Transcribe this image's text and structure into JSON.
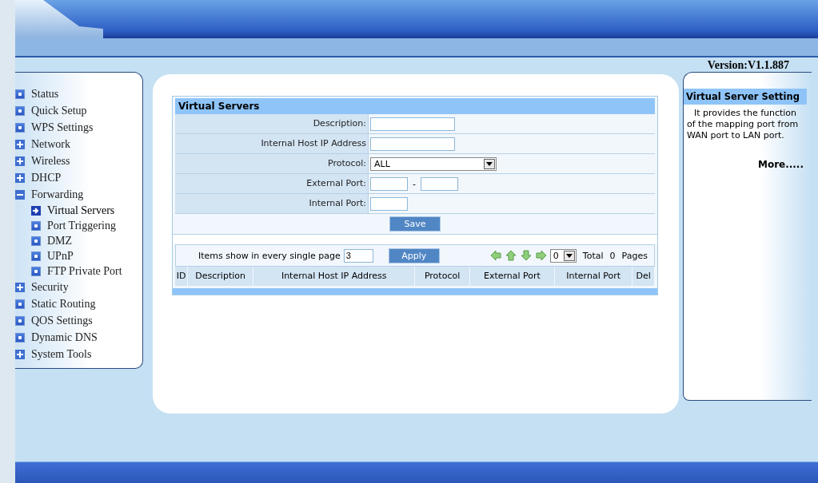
{
  "version": "Version:V1.1.887",
  "sidebar": {
    "items": [
      {
        "label": "Status",
        "kind": "page",
        "selected": false
      },
      {
        "label": "Quick Setup",
        "kind": "page",
        "selected": false
      },
      {
        "label": "WPS Settings",
        "kind": "page",
        "selected": false
      },
      {
        "label": "Network",
        "kind": "folder",
        "expanded": false,
        "selected": false
      },
      {
        "label": "Wireless",
        "kind": "folder",
        "expanded": false,
        "selected": false
      },
      {
        "label": "DHCP",
        "kind": "folder",
        "expanded": false,
        "selected": false
      },
      {
        "label": "Forwarding",
        "kind": "folder",
        "expanded": true,
        "selected": false,
        "children": [
          {
            "label": "Virtual Servers",
            "selected": true
          },
          {
            "label": "Port Triggering",
            "selected": false
          },
          {
            "label": "DMZ",
            "selected": false
          },
          {
            "label": "UPnP",
            "selected": false
          },
          {
            "label": "FTP Private Port",
            "selected": false
          }
        ]
      },
      {
        "label": "Security",
        "kind": "folder",
        "expanded": false,
        "selected": false
      },
      {
        "label": "Static Routing",
        "kind": "page",
        "selected": false
      },
      {
        "label": "QOS Settings",
        "kind": "page",
        "selected": false
      },
      {
        "label": "Dynamic DNS",
        "kind": "page",
        "selected": false
      },
      {
        "label": "System Tools",
        "kind": "folder",
        "expanded": false,
        "selected": false
      }
    ]
  },
  "form": {
    "title": "Virtual Servers",
    "rows": [
      {
        "label": "Description:",
        "kind": "text"
      },
      {
        "label": "Internal Host IP Address",
        "kind": "text"
      },
      {
        "label": "Protocol:",
        "kind": "select",
        "value": "ALL"
      },
      {
        "label": "External Port:",
        "kind": "range",
        "separator": "-"
      },
      {
        "label": "Internal Port:",
        "kind": "short"
      }
    ],
    "save_button": "Save"
  },
  "paging": {
    "label": "Items show in every single page",
    "value": "3",
    "apply_button": "Apply",
    "page_value": "0",
    "total_label": "Total",
    "total": "0",
    "pages_label": "Pages"
  },
  "table": {
    "columns": [
      "ID",
      "Description",
      "Internal Host IP Address",
      "Protocol",
      "External Port",
      "Internal Port",
      "Del"
    ]
  },
  "help": {
    "title": "Virtual Server Setting",
    "text": "It provides the function of the mapping port from WAN port to LAN port.",
    "more": "More....."
  }
}
